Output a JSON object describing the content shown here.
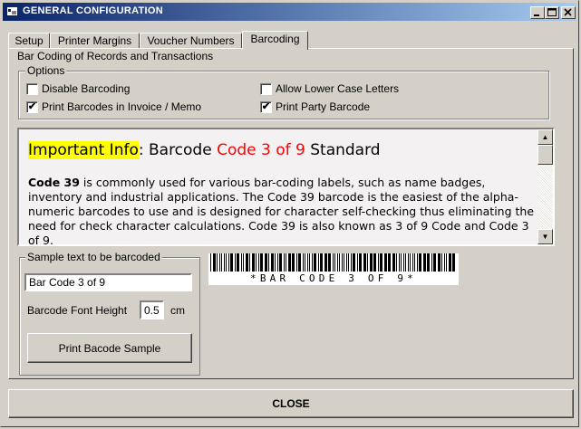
{
  "window": {
    "title": "GENERAL CONFIGURATION",
    "minimize_icon": "minimize-icon",
    "maximize_icon": "maximize-icon",
    "close_icon": "close-icon"
  },
  "tabs": [
    {
      "label": "Setup"
    },
    {
      "label": "Printer Margins"
    },
    {
      "label": "Voucher Numbers"
    },
    {
      "label": "Barcoding",
      "active": true
    }
  ],
  "panel": {
    "group_title": "Bar Coding of Records and Transactions",
    "options_title": "Options",
    "options": {
      "disable_barcoding": {
        "label": "Disable Barcoding",
        "checked": false
      },
      "allow_lower_case": {
        "label": "Allow Lower Case Letters",
        "checked": false
      },
      "print_in_invoice": {
        "label": "Print Barcodes in Invoice / Memo",
        "checked": true
      },
      "print_party": {
        "label": "Print Party Barcode",
        "checked": true
      }
    }
  },
  "info": {
    "heading_highlight": "Important Info",
    "heading_sep": ": Barcode ",
    "heading_red": "Code 3 of 9",
    "heading_end": " Standard",
    "body_bold": "Code 39",
    "body_text": " is commonly used for various bar-coding labels, such as name badges, inventory and industrial applications. The Code 39 barcode is the easiest of the alpha-numeric barcodes to use and is designed for character self-checking thus eliminating the need for check character calculations. Code 39 is also known as 3 of 9 Code and Code 3 of 9."
  },
  "sample": {
    "group_title": "Sample text to be barcoded",
    "text_value": "Bar Code 3 of 9",
    "font_height_label": "Barcode Font Height",
    "font_height_value": "0.5",
    "font_height_unit": "cm",
    "print_button": "Print Bacode Sample"
  },
  "barcode": {
    "text": "*BAR CODE 3 OF 9*"
  },
  "footer": {
    "close_button": "CLOSE"
  }
}
